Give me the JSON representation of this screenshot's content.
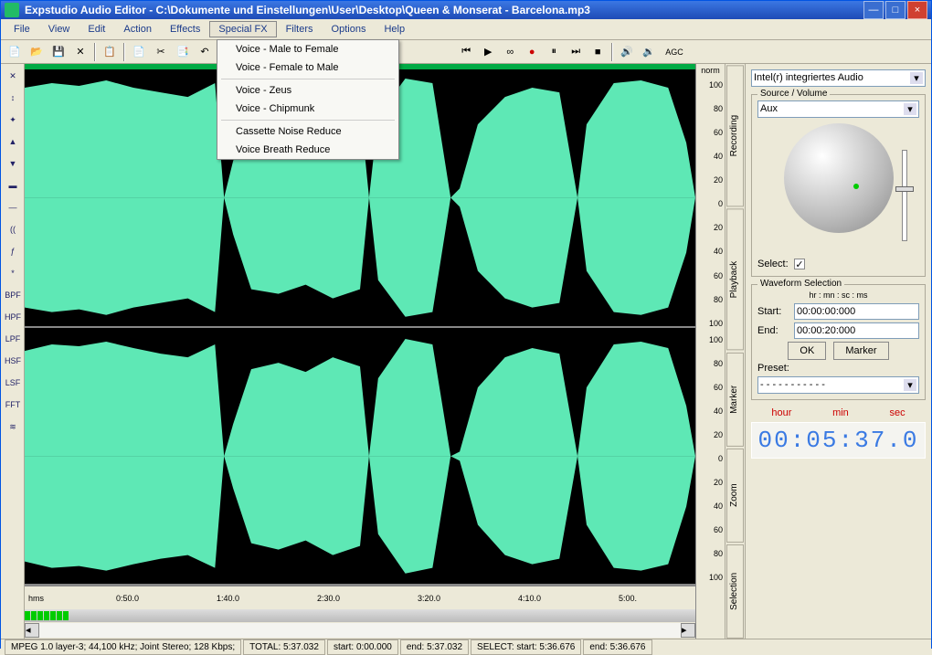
{
  "window": {
    "title": "Expstudio Audio Editor - C:\\Dokumente und Einstellungen\\User\\Desktop\\Queen & Monserat - Barcelona.mp3",
    "min_icon": "—",
    "max_icon": "□",
    "close_icon": "×"
  },
  "menubar": [
    "File",
    "View",
    "Edit",
    "Action",
    "Effects",
    "Special FX",
    "Filters",
    "Options",
    "Help"
  ],
  "menubar_active_index": 5,
  "dropdown": {
    "group1": [
      "Voice - Female to Male",
      "Voice - Male to Female"
    ],
    "group2": [
      "Voice - Chipmunk",
      "Voice - Zeus"
    ],
    "group3": [
      "Voice Breath Reduce",
      "Cassette Noise Reduce"
    ]
  },
  "toolbar_icons": [
    "new",
    "open",
    "save",
    "close",
    "sep",
    "copy",
    "sep",
    "paste",
    "cut",
    "copy2",
    "undo",
    "sep",
    "play-start",
    "play",
    "loop",
    "record",
    "pause",
    "step",
    "stop",
    "sep",
    "speaker-up",
    "speaker",
    "agc"
  ],
  "left_toolbar": [
    "✕",
    "↕",
    "✦",
    "▲",
    "▼",
    "▬",
    "—",
    "((",
    "ƒ",
    "*",
    "BPF",
    "HPF",
    "LPF",
    "HSF",
    "LSF",
    "FFT",
    "≋"
  ],
  "ruler": {
    "norm_label": "norm",
    "ticks": [
      "100",
      "80",
      "60",
      "40",
      "20",
      "0",
      "20",
      "40",
      "60",
      "80",
      "100"
    ]
  },
  "time_axis": {
    "label": "hms",
    "ticks": [
      "0:50.0",
      "1:40.0",
      "2:30.0",
      "3:20.0",
      "4:10.0",
      "5:00."
    ]
  },
  "vtabs_upper": [
    "Recording",
    "Playback"
  ],
  "vtabs_lower": [
    "Marker",
    "Zoom",
    "Selection"
  ],
  "right_panel": {
    "device": "Intel(r) integriertes Audio",
    "source_legend": "Source / Volume",
    "source_value": "Aux",
    "select_label": "Select:",
    "select_checked": "✓",
    "wave_sel": {
      "legend": "Waveform Selection",
      "hint": "hr : mn : sc : ms",
      "start_label": "Start:",
      "start_value": "00:00:00:000",
      "end_label": "End:",
      "end_value": "00:00:20:000",
      "ok_btn": "OK",
      "marker_btn": "Marker",
      "preset_label": "Preset:",
      "preset_value": "- - - - - - - - - - -"
    },
    "clock": {
      "hour": "hour",
      "min": "min",
      "sec": "sec",
      "display": "00:05:37.0"
    }
  },
  "statusbar": {
    "format": "MPEG 1.0 layer-3; 44,100 kHz; Joint Stereo; 128 Kbps;",
    "total": "TOTAL: 5:37.032",
    "start": "start: 0:00.000",
    "end": "end: 5:37.032",
    "select": "SELECT: start: 5:36.676",
    "sel_end": "end: 5:36.676"
  },
  "icons": {
    "agc_label": "AGC"
  }
}
